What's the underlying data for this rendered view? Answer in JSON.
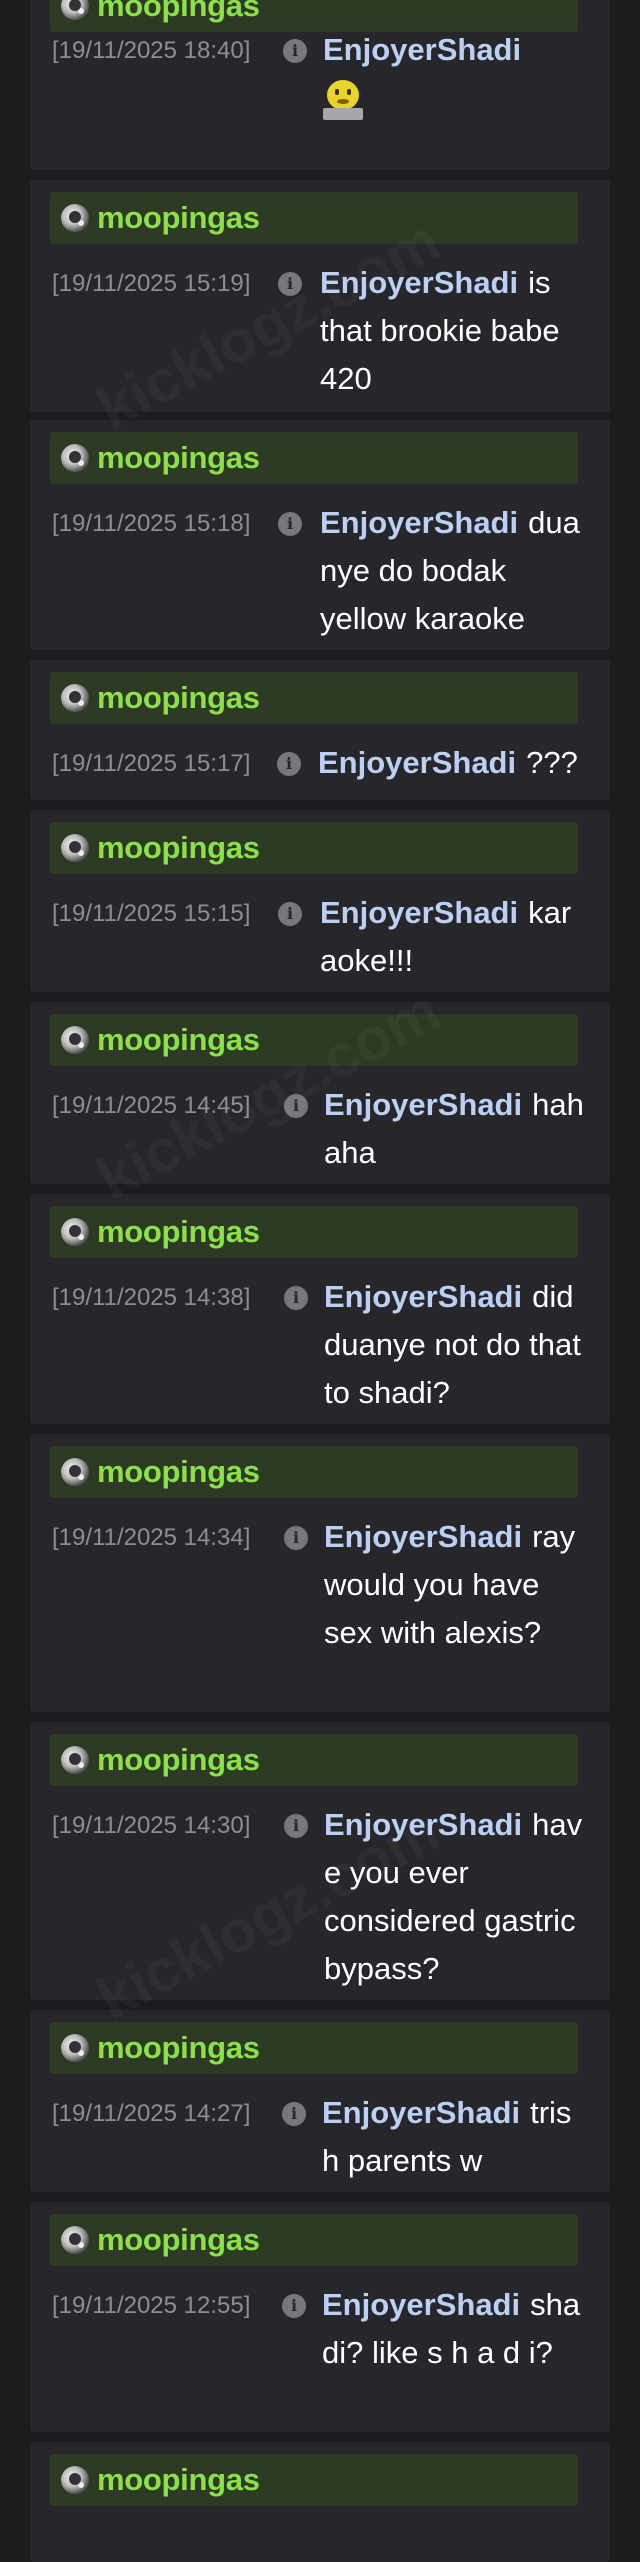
{
  "watermark": "kicklogz.com",
  "messages": [
    {
      "reply_to": "moopingas",
      "timestamp": "[19/11/2025 18:40]",
      "author": "EnjoyerShadi",
      "text": ""
    },
    {
      "reply_to": "moopingas",
      "timestamp": "[19/11/2025 15:19]",
      "author": "EnjoyerShadi",
      "text": "is that brookie babe 420"
    },
    {
      "reply_to": "moopingas",
      "timestamp": "[19/11/2025 15:18]",
      "author": "EnjoyerShadi",
      "text": "duanye do bodak yellow karaoke"
    },
    {
      "reply_to": "moopingas",
      "timestamp": "[19/11/2025 15:17]",
      "author": "EnjoyerShadi",
      "text": "???"
    },
    {
      "reply_to": "moopingas",
      "timestamp": "[19/11/2025 15:15]",
      "author": "EnjoyerShadi",
      "text": "karaoke!!!"
    },
    {
      "reply_to": "moopingas",
      "timestamp": "[19/11/2025 14:45]",
      "author": "EnjoyerShadi",
      "text": "hahaha"
    },
    {
      "reply_to": "moopingas",
      "timestamp": "[19/11/2025 14:38]",
      "author": "EnjoyerShadi",
      "text": "did duanye not do that to shadi?"
    },
    {
      "reply_to": "moopingas",
      "timestamp": "[19/11/2025 14:34]",
      "author": "EnjoyerShadi",
      "text": "ray would you have sex with alexis?"
    },
    {
      "reply_to": "moopingas",
      "timestamp": "[19/11/2025 14:30]",
      "author": "EnjoyerShadi",
      "text": "have you ever considered gastric bypass?"
    },
    {
      "reply_to": "moopingas",
      "timestamp": "[19/11/2025 14:27]",
      "author": "EnjoyerShadi",
      "text": "trish parents w"
    },
    {
      "reply_to": "moopingas",
      "timestamp": "[19/11/2025 12:55]",
      "author": "EnjoyerShadi",
      "text": "shadi? like s h a d i?"
    },
    {
      "reply_to": "moopingas",
      "timestamp": "",
      "author": "",
      "text": ""
    }
  ]
}
